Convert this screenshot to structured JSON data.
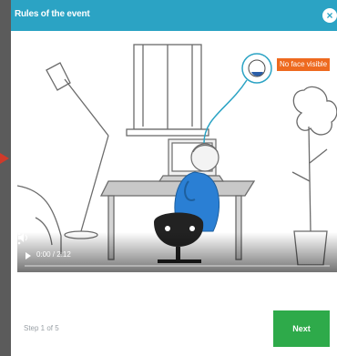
{
  "modal": {
    "title": "Rules of the event",
    "close_icon": "close-icon"
  },
  "video": {
    "annotation_label": "No face visible",
    "time": "0:00 / 2:12",
    "progress": 0,
    "icons": {
      "play": "play-icon",
      "volume": "volume-icon",
      "more": "more-icon"
    }
  },
  "footer": {
    "step_text": "Step 1 of 5",
    "next_label": "Next"
  },
  "colors": {
    "header": "#2ba3c4",
    "next": "#2eaa4a",
    "annotation": "#ee6a1f",
    "person_shirt": "#2a7fd4"
  }
}
